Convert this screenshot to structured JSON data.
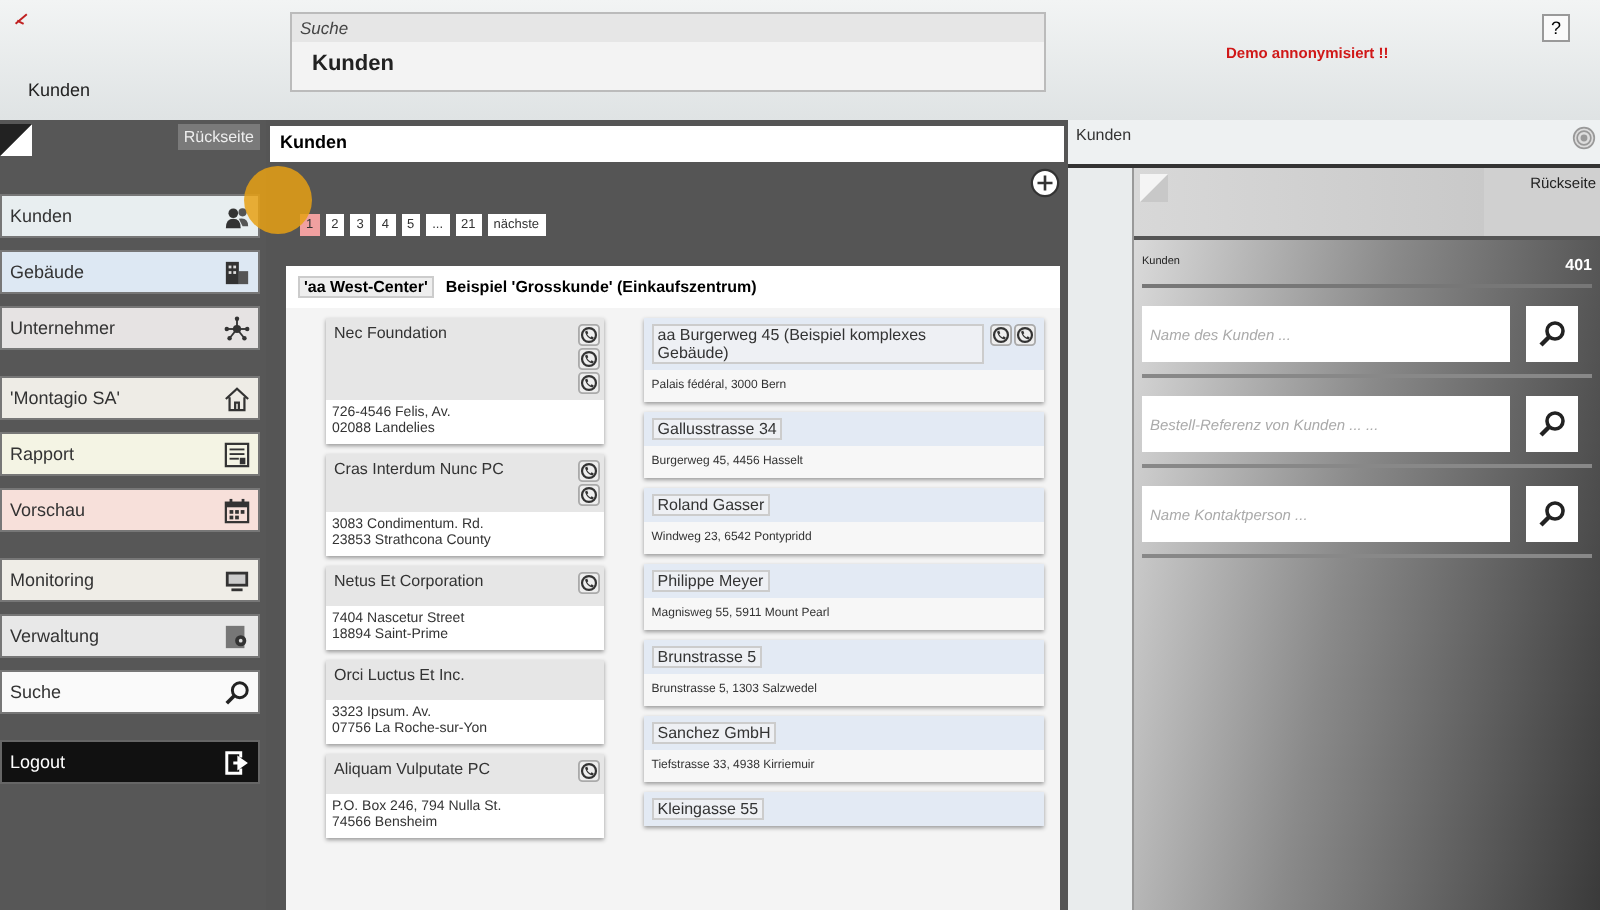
{
  "header": {
    "breadcrumb": "Kunden",
    "search": {
      "label": "Suche",
      "value": "Kunden"
    },
    "notice": "Demo annonymisiert !!",
    "help": "?"
  },
  "sidebar": {
    "back": "Rückseite",
    "groups": [
      {
        "items": [
          {
            "label": "Kunden",
            "kind": "customers",
            "color": "#e8eef0"
          },
          {
            "label": "Gebäude",
            "kind": "buildings",
            "color": "#dde8f3"
          },
          {
            "label": "Unternehmer",
            "kind": "network",
            "color": "#e6e3e3"
          }
        ]
      },
      {
        "items": [
          {
            "label": "'Montagio SA'",
            "kind": "home",
            "color": "#eeece6"
          },
          {
            "label": "Rapport",
            "kind": "report",
            "color": "#f4f4e4"
          },
          {
            "label": "Vorschau",
            "kind": "calendar",
            "color": "#f7e0da"
          }
        ]
      },
      {
        "items": [
          {
            "label": "Monitoring",
            "kind": "monitor",
            "color": "#efede7"
          },
          {
            "label": "Verwaltung",
            "kind": "admin",
            "color": "#e8e8e8"
          },
          {
            "label": "Suche",
            "kind": "search",
            "color": "#fafafa"
          }
        ]
      },
      {
        "items": [
          {
            "label": "Logout",
            "kind": "logout",
            "color": "#111111"
          }
        ]
      }
    ]
  },
  "main": {
    "title": "Kunden",
    "pages": [
      {
        "label": "1",
        "selected": true
      },
      {
        "label": "2",
        "selected": false
      },
      {
        "label": "3",
        "selected": false
      },
      {
        "label": "4",
        "selected": false
      },
      {
        "label": "5",
        "selected": false
      },
      {
        "label": "...",
        "selected": false
      },
      {
        "label": "21",
        "selected": false
      }
    ],
    "next": "nächste",
    "group": {
      "tag": "'aa West-Center'",
      "title": "Beispiel 'Grosskunde' (Einkaufszentrum)",
      "customers": [
        {
          "name": "Nec Foundation",
          "actions": [
            {
              "kind": "phone"
            },
            {
              "kind": "phone"
            },
            {
              "kind": "phone"
            }
          ],
          "lines": [
            "726-4546 Felis, Av.",
            "02088 Landelies"
          ]
        },
        {
          "name": "Cras Interdum Nunc PC",
          "actions": [
            {
              "kind": "phone"
            },
            {
              "kind": "phone"
            }
          ],
          "lines": [
            "3083 Condimentum. Rd.",
            "23853 Strathcona County"
          ]
        },
        {
          "name": "Netus Et Corporation",
          "actions": [
            {
              "kind": "phone"
            }
          ],
          "lines": [
            "7404 Nascetur Street",
            "18894 Saint-Prime"
          ]
        },
        {
          "name": "Orci Luctus Et Inc.",
          "lines": [
            "3323 Ipsum. Av.",
            "07756 La Roche-sur-Yon"
          ]
        },
        {
          "name": "Aliquam Vulputate PC",
          "actions": [
            {
              "kind": "phone"
            }
          ],
          "lines": [
            "P.O. Box 246, 794 Nulla St.",
            "74566 Bensheim"
          ]
        }
      ],
      "buildings": [
        {
          "name": "aa Burgerweg 45 (Beispiel komplexes Gebäude)",
          "actions": [
            {
              "kind": "phone"
            },
            {
              "kind": "phone"
            }
          ],
          "address": "Palais fédéral, 3000 Bern"
        },
        {
          "name": "Gallusstrasse 34",
          "address": "Burgerweg 45, 4456 Hasselt"
        },
        {
          "name": "Roland Gasser",
          "address": "Windweg 23, 6542 Pontypridd"
        },
        {
          "name": "Philippe Meyer",
          "address": "Magnisweg 55, 5911 Mount Pearl"
        },
        {
          "name": "Brunstrasse 5",
          "address": "Brunstrasse 5, 1303 Salzwedel"
        },
        {
          "name": "Sanchez GmbH",
          "address": "Tiefstrasse 33, 4938 Kirriemuir"
        },
        {
          "name": "Kleingasse 55"
        }
      ]
    }
  },
  "panel": {
    "title": "Kunden",
    "back": "Rückseite",
    "count_label": "Kunden",
    "count": "401",
    "fields": [
      {
        "placeholder": "Name des Kunden ..."
      },
      {
        "placeholder": "Bestell-Referenz von Kunden ... ..."
      },
      {
        "placeholder": "Name Kontaktperson ..."
      }
    ]
  }
}
